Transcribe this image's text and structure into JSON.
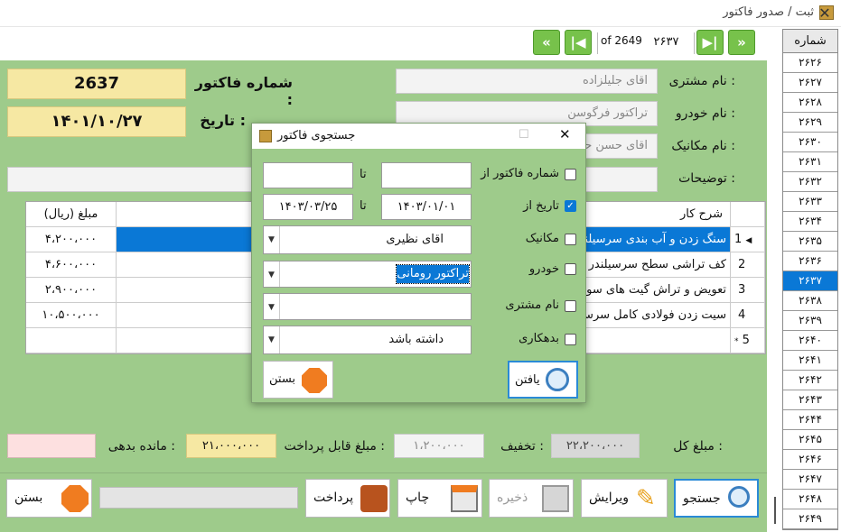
{
  "window": {
    "title": "ثبت / صدور فاکتور"
  },
  "nav": {
    "of_label": "of 2649",
    "record": "۲۶۳۷"
  },
  "form": {
    "invoice_no_label": "شماره فاکتور :",
    "invoice_no": "2637",
    "date_label": "تاریخ :",
    "date": "۱۴۰۱/۱۰/۲۷",
    "customer_label": "نام مشتری :",
    "customer": "اقای جلیلزاده",
    "car_label": "نام خودرو :",
    "car": "تراکتور فرگوسن",
    "mechanic_label": "نام مکانیک :",
    "mechanic": "اقای حسن حیـ",
    "notes_label": "توضیحات :"
  },
  "grid": {
    "headers": {
      "desc": "شرح کار",
      "amount": "مبلغ (ریال)"
    },
    "rows": [
      {
        "n": "1",
        "desc": "سنگ زدن و آب بندی سرسیلندر",
        "amount": "۴،۲۰۰،۰۰۰"
      },
      {
        "n": "2",
        "desc": "کف تراشی سطح سرسیلندر",
        "amount": "۴،۶۰۰،۰۰۰"
      },
      {
        "n": "3",
        "desc": "تعویض و تراش گیت های سوپاپ",
        "amount": "۲،۹۰۰،۰۰۰"
      },
      {
        "n": "4",
        "desc": "سیت زدن فولادی کامل سرسیلندر",
        "amount": "۱۰،۵۰۰،۰۰۰"
      },
      {
        "n": "5",
        "desc": "",
        "amount": ""
      }
    ],
    "current_marker": "◀",
    "new_marker": "*"
  },
  "totals": {
    "total_label": "مبلغ کل :",
    "total": "۲۲،۲۰۰،۰۰۰",
    "discount_label": "تخفیف :",
    "discount": "۱،۲۰۰،۰۰۰",
    "payable_label": "مبلغ قابل پرداخت :",
    "payable": "۲۱،۰۰۰،۰۰۰",
    "debt_label": "مانده بدهی :"
  },
  "buttons": {
    "search": "جستجو",
    "edit": "ویرایش",
    "save": "ذخیره",
    "print": "چاپ",
    "pay": "پرداخت",
    "close": "بستن"
  },
  "list": {
    "header": "شماره",
    "items": [
      "۲۶۲۶",
      "۲۶۲۷",
      "۲۶۲۸",
      "۲۶۲۹",
      "۲۶۳۰",
      "۲۶۳۱",
      "۲۶۳۲",
      "۲۶۳۳",
      "۲۶۳۴",
      "۲۶۳۵",
      "۲۶۳۶",
      "۲۶۳۷",
      "۲۶۳۸",
      "۲۶۳۹",
      "۲۶۴۰",
      "۲۶۴۱",
      "۲۶۴۲",
      "۲۶۴۳",
      "۲۶۴۴",
      "۲۶۴۵",
      "۲۶۴۶",
      "۲۶۴۷",
      "۲۶۴۸",
      "۲۶۴۹"
    ]
  },
  "dialog": {
    "title": "جستجوی فاکتور",
    "invoice_from_label": "شماره فاکتور از",
    "to_label": "تا",
    "to_label2": "تا",
    "date_from_label": "تاریخ از",
    "date_from": "۱۴۰۳/۰۱/۰۱",
    "date_to": "۱۴۰۳/۰۳/۲۵",
    "mechanic_label": "مکانیک",
    "mechanic_value": "اقای نظیری",
    "car_label": "خودرو",
    "car_value": "تراکتور رومانی",
    "customer_label": "نام مشتری",
    "debt_label": "بدهکاری",
    "debt_value": "داشته باشد",
    "find_label": "یافتن",
    "close_label": "بستن"
  }
}
